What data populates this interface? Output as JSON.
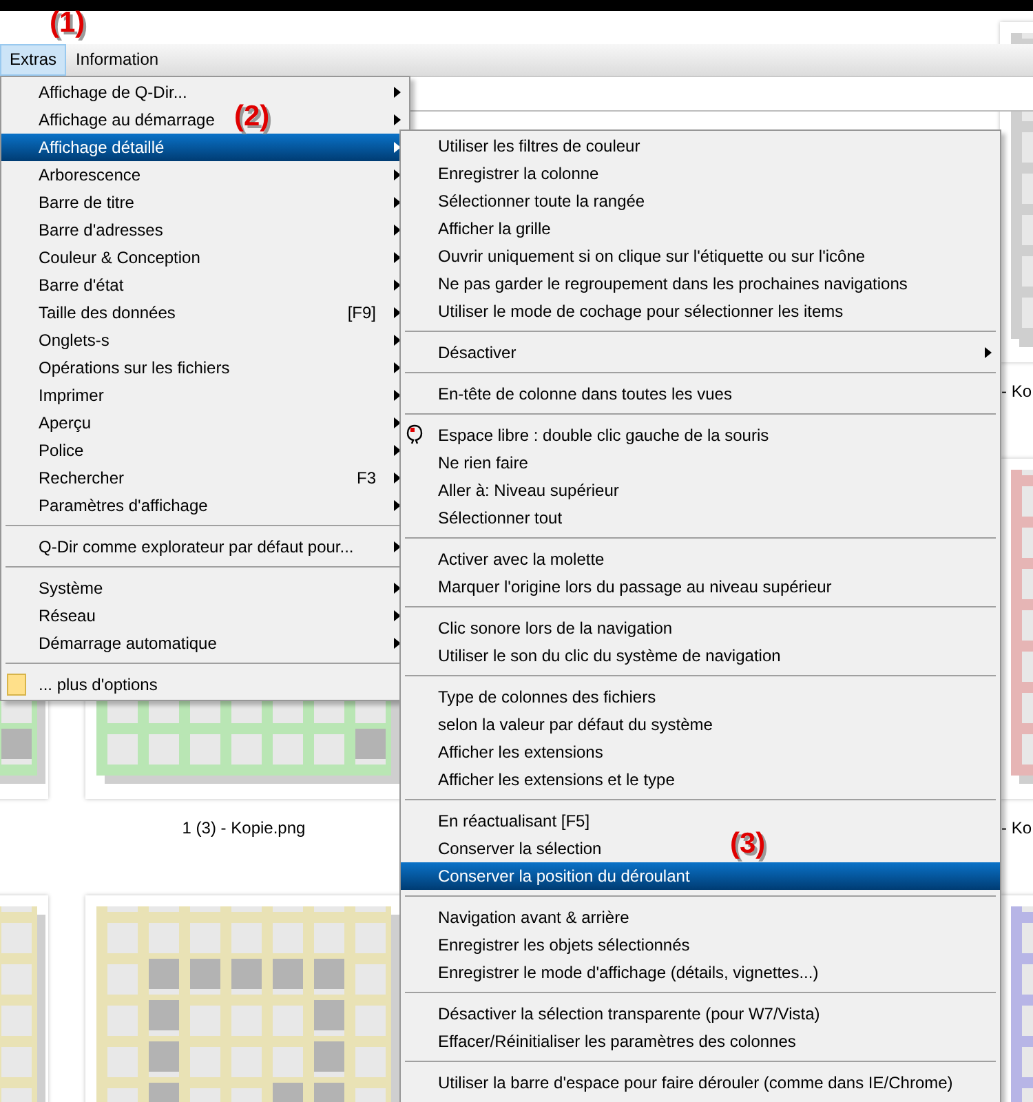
{
  "annotations": [
    {
      "label": "(1)"
    },
    {
      "label": "(2)"
    },
    {
      "label": "(3)"
    }
  ],
  "menubar": [
    {
      "label": "Extras",
      "selected": true
    },
    {
      "label": "Information",
      "selected": false
    }
  ],
  "thumbnails": [
    {
      "color": "#cfcfcf",
      "caption": "- Ko"
    },
    {
      "color": "#b9e6b4"
    },
    {
      "color": "#b9e6b4",
      "caption": "1 (3) - Kopie.png"
    },
    {
      "color": "#e6b5b5",
      "caption": "- Ko"
    },
    {
      "color": "#e9e2b5"
    },
    {
      "color": "#e9e2b5"
    },
    {
      "color": "#b7b5e6"
    }
  ],
  "main_menu": {
    "items": [
      {
        "kind": "item",
        "label": "Affichage de Q-Dir...",
        "has_submenu": true,
        "selected": false
      },
      {
        "kind": "item",
        "label": "Affichage au démarrage",
        "has_submenu": true,
        "selected": false
      },
      {
        "kind": "item",
        "label": "Affichage détaillé",
        "has_submenu": true,
        "selected": true
      },
      {
        "kind": "item",
        "label": "Arborescence",
        "has_submenu": true,
        "selected": false
      },
      {
        "kind": "item",
        "label": "Barre de titre",
        "has_submenu": true,
        "selected": false
      },
      {
        "kind": "item",
        "label": "Barre d'adresses",
        "has_submenu": true,
        "selected": false
      },
      {
        "kind": "item",
        "label": "Couleur & Conception",
        "has_submenu": true,
        "selected": false
      },
      {
        "kind": "item",
        "label": "Barre d'état",
        "has_submenu": true,
        "selected": false
      },
      {
        "kind": "item",
        "label": "Taille des données",
        "shortcut": "[F9]",
        "has_submenu": true,
        "selected": false
      },
      {
        "kind": "item",
        "label": "Onglets-s",
        "has_submenu": true,
        "selected": false
      },
      {
        "kind": "item",
        "label": "Opérations sur les fichiers",
        "has_submenu": true,
        "selected": false
      },
      {
        "kind": "item",
        "label": "Imprimer",
        "has_submenu": true,
        "selected": false
      },
      {
        "kind": "item",
        "label": "Aperçu",
        "has_submenu": true,
        "selected": false
      },
      {
        "kind": "item",
        "label": "Police",
        "has_submenu": true,
        "selected": false
      },
      {
        "kind": "item",
        "label": "Rechercher",
        "shortcut": "F3",
        "has_submenu": true,
        "selected": false
      },
      {
        "kind": "item",
        "label": "Paramètres d'affichage",
        "has_submenu": true,
        "selected": false
      },
      {
        "kind": "separator"
      },
      {
        "kind": "item",
        "label": "Q-Dir comme explorateur par défaut pour...",
        "has_submenu": true,
        "selected": false
      },
      {
        "kind": "separator"
      },
      {
        "kind": "item",
        "label": "Système",
        "has_submenu": true,
        "selected": false
      },
      {
        "kind": "item",
        "label": "Réseau",
        "has_submenu": true,
        "selected": false
      },
      {
        "kind": "item",
        "label": "Démarrage automatique",
        "has_submenu": true,
        "selected": false
      },
      {
        "kind": "separator"
      },
      {
        "kind": "item",
        "label": "... plus d'options",
        "has_icon": true,
        "has_submenu": false,
        "selected": false
      }
    ]
  },
  "submenu": {
    "items": [
      {
        "kind": "item",
        "label": "Utiliser les filtres de couleur",
        "has_submenu": false,
        "selected": false
      },
      {
        "kind": "item",
        "label": "Enregistrer la colonne",
        "has_submenu": false,
        "selected": false
      },
      {
        "kind": "item",
        "label": "Sélectionner toute la rangée",
        "has_submenu": false,
        "selected": false
      },
      {
        "kind": "item",
        "label": "Afficher la grille",
        "has_submenu": false,
        "selected": false
      },
      {
        "kind": "item",
        "label": "Ouvrir uniquement si on clique sur l'étiquette ou sur l'icône",
        "has_submenu": false,
        "selected": false
      },
      {
        "kind": "item",
        "label": "Ne pas garder le regroupement dans les prochaines navigations",
        "has_submenu": false,
        "selected": false
      },
      {
        "kind": "item",
        "label": "Utiliser le mode de cochage pour sélectionner les items",
        "has_submenu": false,
        "selected": false
      },
      {
        "kind": "separator"
      },
      {
        "kind": "item",
        "label": "Désactiver",
        "has_submenu": true,
        "selected": false
      },
      {
        "kind": "separator"
      },
      {
        "kind": "item",
        "label": "En-tête de colonne dans toutes les vues",
        "has_submenu": false,
        "selected": false
      },
      {
        "kind": "separator"
      },
      {
        "kind": "item",
        "label": "Espace libre : double clic gauche de la souris",
        "has_icon": true,
        "has_submenu": false,
        "selected": false
      },
      {
        "kind": "item",
        "label": "Ne rien faire",
        "has_submenu": false,
        "selected": false
      },
      {
        "kind": "item",
        "label": "Aller à: Niveau supérieur",
        "has_submenu": false,
        "selected": false
      },
      {
        "kind": "item",
        "label": "Sélectionner tout",
        "has_submenu": false,
        "selected": false
      },
      {
        "kind": "separator"
      },
      {
        "kind": "item",
        "label": "Activer avec la molette",
        "has_submenu": false,
        "selected": false
      },
      {
        "kind": "item",
        "label": "Marquer l'origine lors du passage au niveau supérieur",
        "has_submenu": false,
        "selected": false
      },
      {
        "kind": "separator"
      },
      {
        "kind": "item",
        "label": "Clic sonore lors de la navigation",
        "has_submenu": false,
        "selected": false
      },
      {
        "kind": "item",
        "label": "Utiliser le son du clic du système de navigation",
        "has_submenu": false,
        "selected": false
      },
      {
        "kind": "separator"
      },
      {
        "kind": "item",
        "label": "Type de colonnes des fichiers",
        "has_submenu": false,
        "selected": false
      },
      {
        "kind": "item",
        "label": "selon la valeur par défaut du système",
        "has_submenu": false,
        "selected": false
      },
      {
        "kind": "item",
        "label": "Afficher les extensions",
        "has_submenu": false,
        "selected": false
      },
      {
        "kind": "item",
        "label": "Afficher les extensions et le type",
        "has_submenu": false,
        "selected": false
      },
      {
        "kind": "separator"
      },
      {
        "kind": "item",
        "label": "En réactualisant [F5]",
        "has_submenu": false,
        "selected": false
      },
      {
        "kind": "item",
        "label": "Conserver la sélection",
        "has_submenu": false,
        "selected": false
      },
      {
        "kind": "item",
        "label": "Conserver la position du déroulant",
        "has_submenu": false,
        "selected": true
      },
      {
        "kind": "separator"
      },
      {
        "kind": "item",
        "label": "Navigation avant & arrière",
        "has_submenu": false,
        "selected": false
      },
      {
        "kind": "item",
        "label": "Enregistrer les objets sélectionnés",
        "has_submenu": false,
        "selected": false
      },
      {
        "kind": "item",
        "label": "Enregistrer le mode d'affichage (détails, vignettes...)",
        "has_submenu": false,
        "selected": false
      },
      {
        "kind": "separator"
      },
      {
        "kind": "item",
        "label": "Désactiver la sélection transparente (pour W7/Vista)",
        "has_submenu": false,
        "selected": false
      },
      {
        "kind": "item",
        "label": "Effacer/Réinitialiser les paramètres des colonnes",
        "has_submenu": false,
        "selected": false
      },
      {
        "kind": "separator"
      },
      {
        "kind": "item",
        "label": "Utiliser la barre d'espace pour faire dérouler (comme dans IE/Chrome)",
        "has_submenu": false,
        "selected": false
      }
    ]
  }
}
